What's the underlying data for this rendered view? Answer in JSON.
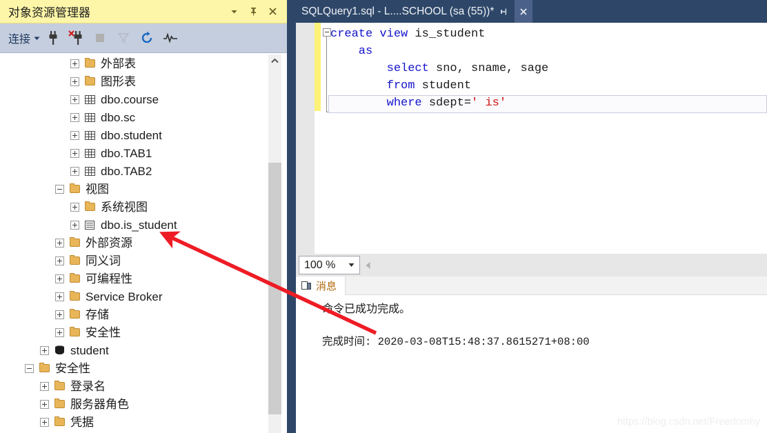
{
  "colors": {
    "oe_header_bg": "#fdf6a8",
    "oe_toolbar_bg": "#c5cede",
    "divider": "#2e4769",
    "tab_bg": "#2e4769",
    "keyword": "#1414cc",
    "string": "#d01414",
    "arrow": "#ee1c25",
    "results_tab_label": "#b06a10"
  },
  "object_explorer": {
    "title": "对象资源管理器",
    "header_buttons": [
      {
        "name": "dropdown-icon",
        "glyph": "▾"
      },
      {
        "name": "pin-icon",
        "glyph": "⇥"
      },
      {
        "name": "close-icon",
        "glyph": "✕"
      }
    ],
    "toolbar": {
      "connect_label": "连接",
      "connect_caret": "▾",
      "icons": [
        {
          "name": "connect-icon"
        },
        {
          "name": "disconnect-icon"
        },
        {
          "name": "stop-icon"
        },
        {
          "name": "filter-icon"
        },
        {
          "name": "refresh-icon"
        },
        {
          "name": "activity-monitor-icon"
        }
      ]
    },
    "tree": [
      {
        "label": "外部表",
        "icon": "folder",
        "expander": "plus",
        "indent": 3
      },
      {
        "label": "图形表",
        "icon": "folder",
        "expander": "plus",
        "indent": 3
      },
      {
        "label": "dbo.course",
        "icon": "table",
        "expander": "plus",
        "indent": 3
      },
      {
        "label": "dbo.sc",
        "icon": "table",
        "expander": "plus",
        "indent": 3
      },
      {
        "label": "dbo.student",
        "icon": "table",
        "expander": "plus",
        "indent": 3
      },
      {
        "label": "dbo.TAB1",
        "icon": "table",
        "expander": "plus",
        "indent": 3
      },
      {
        "label": "dbo.TAB2",
        "icon": "table",
        "expander": "plus",
        "indent": 3
      },
      {
        "label": "视图",
        "icon": "folder",
        "expander": "minus",
        "indent": 2
      },
      {
        "label": "系统视图",
        "icon": "folder",
        "expander": "plus",
        "indent": 3
      },
      {
        "label": "dbo.is_student",
        "icon": "view",
        "expander": "plus",
        "indent": 3
      },
      {
        "label": "外部资源",
        "icon": "folder",
        "expander": "plus",
        "indent": 2
      },
      {
        "label": "同义词",
        "icon": "folder",
        "expander": "plus",
        "indent": 2
      },
      {
        "label": "可编程性",
        "icon": "folder",
        "expander": "plus",
        "indent": 2
      },
      {
        "label": "Service Broker",
        "icon": "folder",
        "expander": "plus",
        "indent": 2
      },
      {
        "label": "存储",
        "icon": "folder",
        "expander": "plus",
        "indent": 2
      },
      {
        "label": "安全性",
        "icon": "folder",
        "expander": "plus",
        "indent": 2
      },
      {
        "label": "student",
        "icon": "db",
        "expander": "plus",
        "indent": 1
      },
      {
        "label": "安全性",
        "icon": "folder",
        "expander": "minus",
        "indent": 0
      },
      {
        "label": "登录名",
        "icon": "folder",
        "expander": "plus",
        "indent": 1
      },
      {
        "label": "服务器角色",
        "icon": "folder",
        "expander": "plus",
        "indent": 1
      },
      {
        "label": "凭据",
        "icon": "folder",
        "expander": "plus",
        "indent": 1
      }
    ]
  },
  "editor": {
    "tab": {
      "title": "SQLQuery1.sql - L....SCHOOL (sa (55))*",
      "pin_glyph": "⇥",
      "close_glyph": "✕"
    },
    "code": {
      "lines": [
        [
          {
            "t": "create view ",
            "c": "kw"
          },
          {
            "t": "is_student",
            "c": ""
          }
        ],
        [
          {
            "t": "    as",
            "c": "kw"
          }
        ],
        [
          {
            "t": "        select ",
            "c": "kw"
          },
          {
            "t": "sno, sname, sage",
            "c": ""
          }
        ],
        [
          {
            "t": "        from ",
            "c": "kw"
          },
          {
            "t": "student",
            "c": ""
          }
        ],
        [
          {
            "t": "        where ",
            "c": "kw"
          },
          {
            "t": "sdept=",
            "c": ""
          },
          {
            "t": "' is'",
            "c": "str"
          }
        ]
      ]
    },
    "zoom_bar": {
      "value": "100 %",
      "caret": "▼",
      "left_arrow": "◀"
    },
    "results": {
      "tab_label": "消息",
      "messages": [
        "命令已成功完成。"
      ],
      "completion_label": "完成时间: ",
      "completion_time": "2020-03-08T15:48:37.8615271+08:00"
    }
  },
  "watermark": "https://blog.csdn.net/Freedomhy"
}
